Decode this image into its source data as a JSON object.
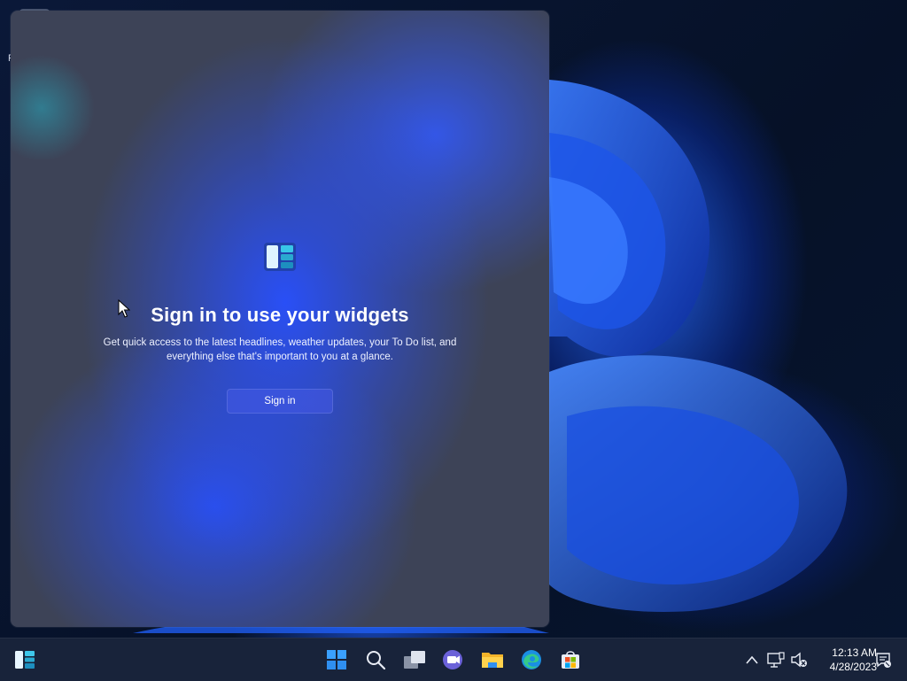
{
  "desktop": {
    "icon_label": "R"
  },
  "widgets": {
    "title": "Sign in to use your widgets",
    "description": "Get quick access to the latest headlines, weather updates, your To Do list, and everything else that's important to you at a glance.",
    "sign_in_label": "Sign in",
    "logo_icon": "widgets-logo-icon"
  },
  "taskbar": {
    "left_icon": "widgets-icon",
    "center_icons": [
      "start-icon",
      "search-icon",
      "task-view-icon",
      "chat-icon",
      "file-explorer-icon",
      "edge-icon",
      "store-icon"
    ],
    "tray_icons": [
      "chevron-up-icon",
      "network-icon",
      "volume-muted-icon",
      "notification-icon"
    ],
    "time": "12:13 AM",
    "date": "4/28/2023"
  },
  "colors": {
    "accent": "#2f6bff",
    "taskbar_bg": "#18233a",
    "panel_bg": "#3d4357",
    "desktop_bg": "#061127"
  }
}
